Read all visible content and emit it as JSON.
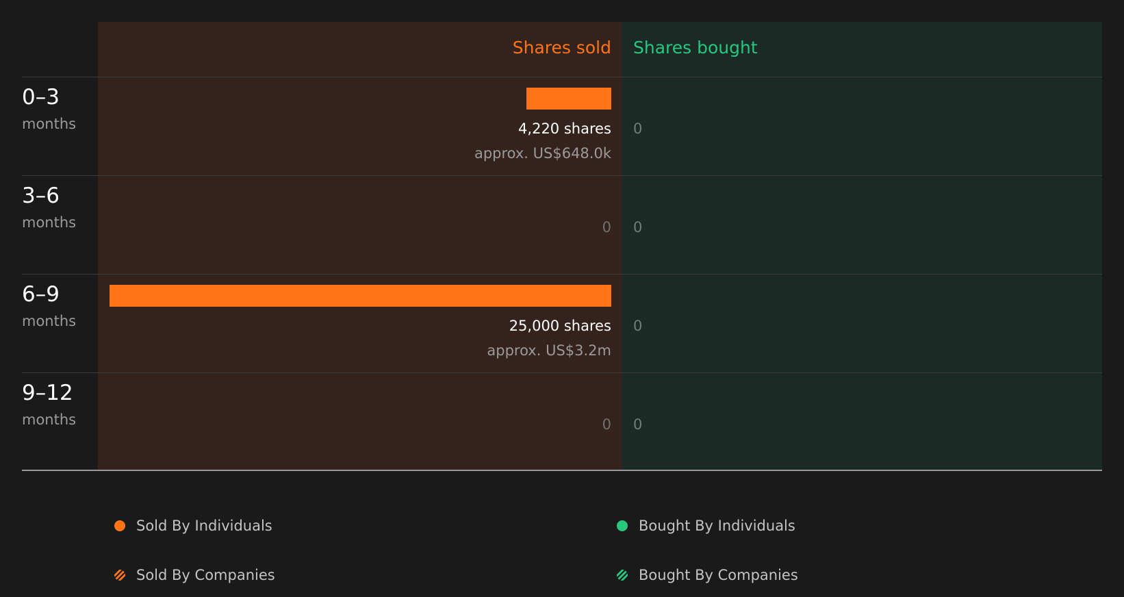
{
  "colors": {
    "sold": "#ff7416",
    "bought": "#27c780",
    "sold_panel": "#33231c",
    "bought_panel": "#1b2a24"
  },
  "chart_data": {
    "type": "bar",
    "headers": {
      "sold": "Shares sold",
      "bought": "Shares bought"
    },
    "categories": [
      {
        "range": "0–3",
        "unit": "months"
      },
      {
        "range": "3–6",
        "unit": "months"
      },
      {
        "range": "6–9",
        "unit": "months"
      },
      {
        "range": "9–12",
        "unit": "months"
      }
    ],
    "series": [
      {
        "name": "Shares sold",
        "values": [
          4220,
          0,
          25000,
          0
        ],
        "labels": [
          "4,220 shares",
          "0",
          "25,000 shares",
          "0"
        ],
        "approx": [
          "approx. US$648.0k",
          "",
          "approx. US$3.2m",
          ""
        ]
      },
      {
        "name": "Shares bought",
        "values": [
          0,
          0,
          0,
          0
        ],
        "labels": [
          "0",
          "0",
          "0",
          "0"
        ]
      }
    ],
    "xlim": [
      0,
      25000
    ],
    "legend": [
      {
        "label": "Sold By Individuals",
        "style": "solid",
        "series": "sold"
      },
      {
        "label": "Bought By Individuals",
        "style": "solid",
        "series": "bought"
      },
      {
        "label": "Sold By Companies",
        "style": "hatched",
        "series": "sold"
      },
      {
        "label": "Bought By Companies",
        "style": "hatched",
        "series": "bought"
      }
    ],
    "legend_position": "bottom"
  }
}
